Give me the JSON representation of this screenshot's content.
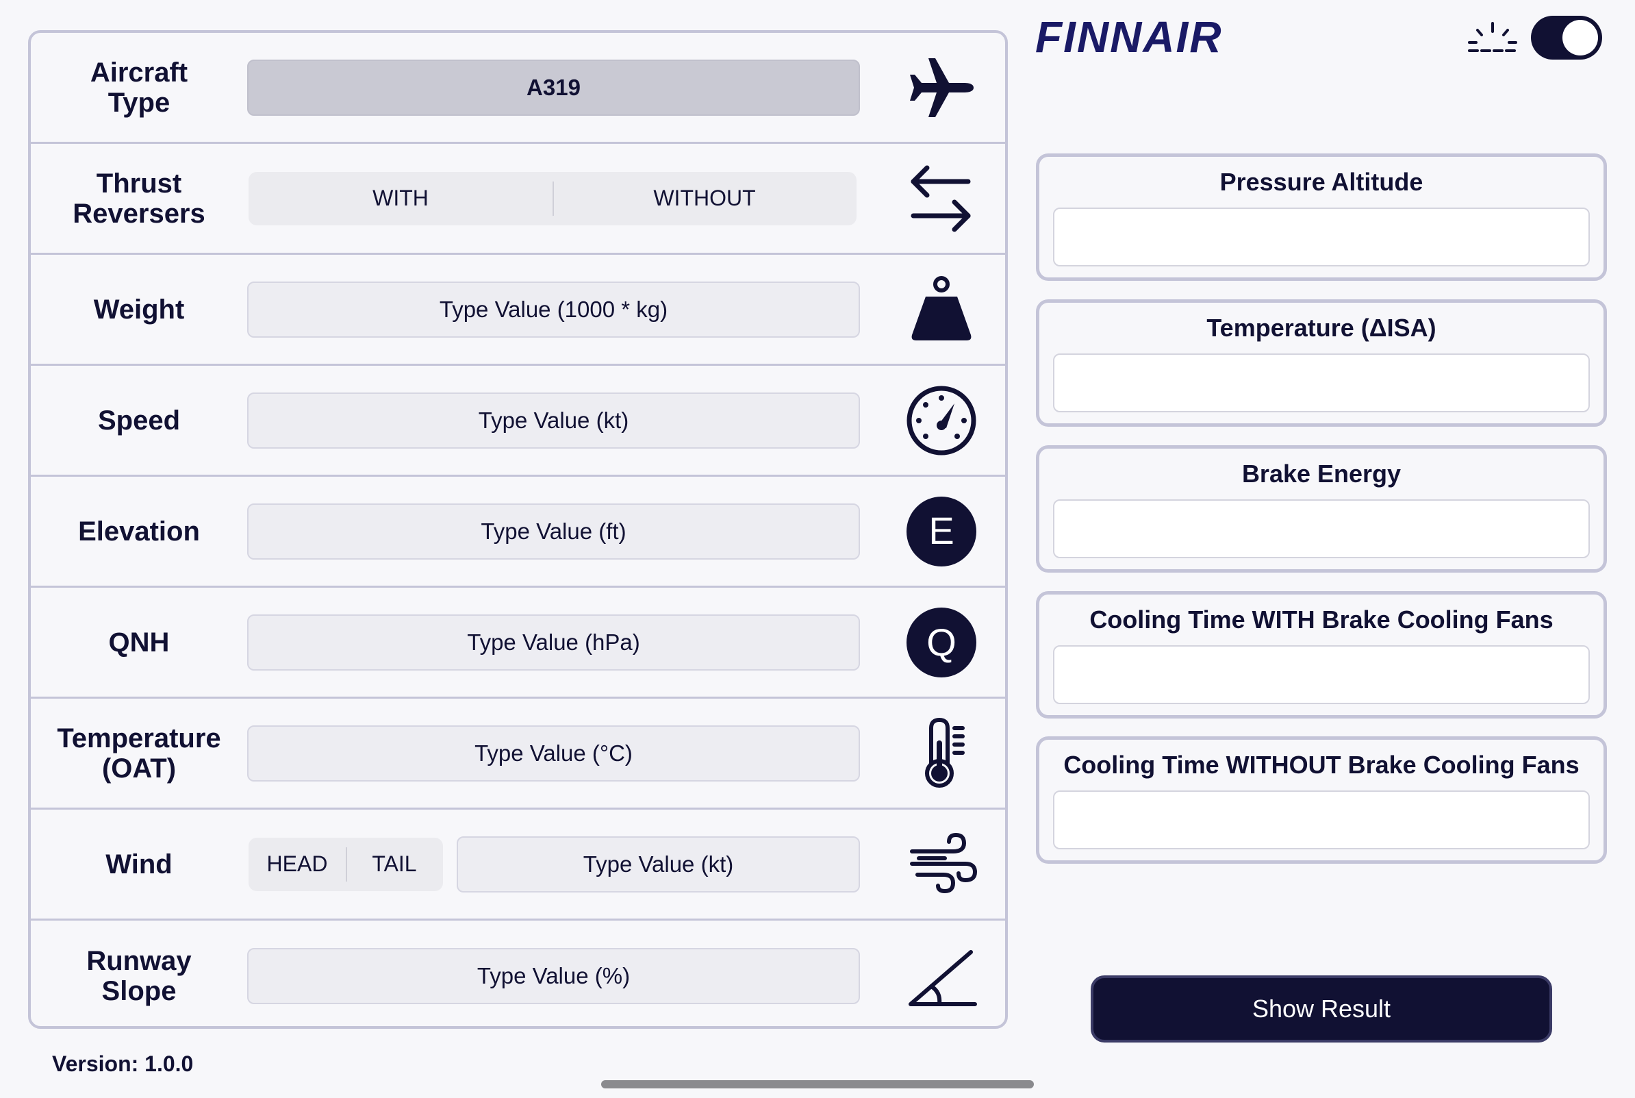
{
  "brand": {
    "logo_text": "FINNAIR",
    "color": "#1a1a66"
  },
  "theme": {
    "toggle_on": true,
    "sun_icon": "sun-icon"
  },
  "form": {
    "aircraft_type": {
      "label": "Aircraft\nType",
      "value": "A319",
      "icon": "airplane-icon"
    },
    "thrust_reversers": {
      "label": "Thrust\nReversers",
      "options": [
        "WITH",
        "WITHOUT"
      ],
      "icon": "arrows-left-right-icon"
    },
    "weight": {
      "label": "Weight",
      "placeholder": "Type Value (1000 * kg)",
      "icon": "weight-icon"
    },
    "speed": {
      "label": "Speed",
      "placeholder": "Type Value (kt)",
      "icon": "speedometer-icon"
    },
    "elevation": {
      "label": "Elevation",
      "placeholder": "Type Value (ft)",
      "icon": "letter-e-icon",
      "icon_letter": "E"
    },
    "qnh": {
      "label": "QNH",
      "placeholder": "Type Value (hPa)",
      "icon": "letter-q-icon",
      "icon_letter": "Q"
    },
    "temperature": {
      "label": "Temperature\n(OAT)",
      "placeholder": "Type Value (°C)",
      "icon": "thermometer-icon"
    },
    "wind": {
      "label": "Wind",
      "options": [
        "HEAD",
        "TAIL"
      ],
      "placeholder": "Type Value (kt)",
      "icon": "wind-icon"
    },
    "runway_slope": {
      "label": "Runway\nSlope",
      "placeholder": "Type Value (%)",
      "icon": "slope-angle-icon"
    }
  },
  "results": [
    {
      "title": "Pressure Altitude",
      "value": ""
    },
    {
      "title": "Temperature (ΔISA)",
      "value": ""
    },
    {
      "title": "Brake Energy",
      "value": ""
    },
    {
      "title": "Cooling Time WITH Brake Cooling Fans",
      "value": ""
    },
    {
      "title": "Cooling Time WITHOUT Brake Cooling Fans",
      "value": ""
    }
  ],
  "show_result_label": "Show Result",
  "version_text": "Version: 1.0.0"
}
